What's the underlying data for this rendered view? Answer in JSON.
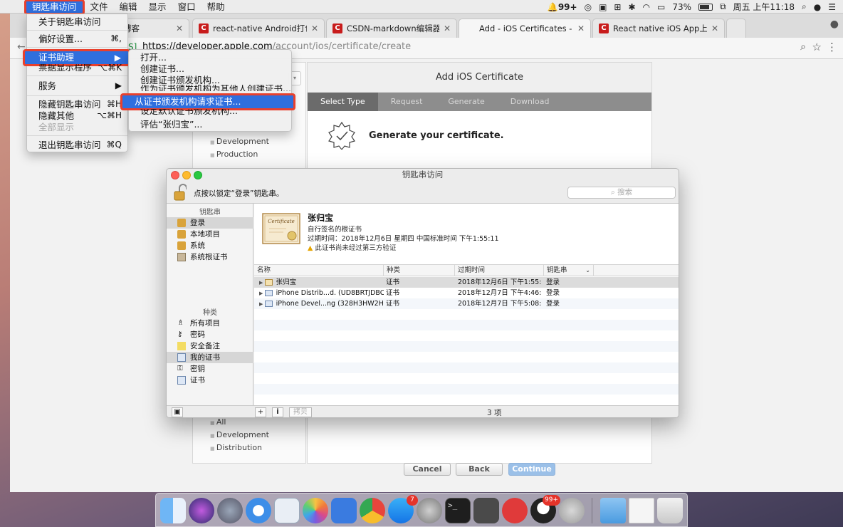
{
  "menubar": {
    "items": [
      "钥匙串访问",
      "文件",
      "编辑",
      "显示",
      "窗口",
      "帮助"
    ],
    "right": {
      "notifications": "99+",
      "battery": "73%",
      "clock": "周五 上午11:18"
    }
  },
  "browser": {
    "tabs": [
      {
        "label": "博客"
      },
      {
        "label": "react-native Android打包apk -"
      },
      {
        "label": "CSDN-markdown编辑器"
      },
      {
        "label": "Add - iOS Certificates - Apple"
      },
      {
        "label": "React native iOS App上架流程"
      }
    ],
    "url": {
      "scheme_tail": "S]",
      "host": "https://developer.apple.com",
      "path": "/account/ios/certificate/create"
    }
  },
  "page": {
    "panel_title": "Add iOS Certificate",
    "steps": [
      "Select Type",
      "Request",
      "Generate",
      "Download"
    ],
    "heading": "Generate your certificate.",
    "sidebar_top": [
      "Development",
      "Production"
    ],
    "sidebar_bottom": [
      "All",
      "Development",
      "Distribution"
    ],
    "buttons": {
      "cancel": "Cancel",
      "back": "Back",
      "continue": "Continue"
    }
  },
  "app_menu": {
    "items": [
      {
        "label": "关于钥匙串访问",
        "shortcut": ""
      },
      {
        "label": "偏好设置...",
        "shortcut": "⌘,"
      },
      {
        "label": "证书助理",
        "shortcut": "▶"
      },
      {
        "label": "票据显示程序",
        "shortcut": "⌥⌘K"
      },
      {
        "label": "服务",
        "shortcut": "▶"
      },
      {
        "label": "隐藏钥匙串访问",
        "shortcut": "⌘H"
      },
      {
        "label": "隐藏其他",
        "shortcut": "⌥⌘H"
      },
      {
        "label": "全部显示",
        "shortcut": ""
      },
      {
        "label": "退出钥匙串访问",
        "shortcut": "⌘Q"
      }
    ]
  },
  "cert_submenu": {
    "items": [
      "打开...",
      "创建证书...",
      "创建证书颁发机构...",
      "作为证书颁发机构为其他人创建证书...",
      "从证书颁发机构请求证书...",
      "设定默认证书颁发机构...",
      "评估“张归宝”..."
    ]
  },
  "keychain": {
    "title": "钥匙串访问",
    "lock_text": "点按以锁定“登录”钥匙串。",
    "search_placeholder": "搜索",
    "keychains_header": "钥匙串",
    "keychains": [
      "登录",
      "本地项目",
      "系统",
      "系统根证书"
    ],
    "categories_header": "种类",
    "categories": [
      "所有项目",
      "密码",
      "安全备注",
      "我的证书",
      "密钥",
      "证书"
    ],
    "detail": {
      "name": "张归宝",
      "kind": "自行签名的根证书",
      "expiry": "过期时间：2018年12月6日 星期四 中国标准时间 下午1:55:11",
      "warning": "此证书尚未经过第三方验证",
      "cert_text": "Certificate"
    },
    "columns": [
      "名称",
      "种类",
      "过期时间",
      "钥匙串"
    ],
    "rows": [
      {
        "name": "张归宝",
        "kind": "证书",
        "expires": "2018年12月6日 下午1:55:11",
        "keychain": "登录"
      },
      {
        "name": "iPhone Distrib...d. (UD8BRTJDBC)",
        "kind": "证书",
        "expires": "2018年12月7日 下午4:46:...",
        "keychain": "登录"
      },
      {
        "name": "iPhone Devel...ng (328H3HW2HB)",
        "kind": "证书",
        "expires": "2018年12月7日 下午5:08:...",
        "keychain": "登录"
      }
    ],
    "copy_button": "拷贝",
    "count": "3 项"
  },
  "dock": {
    "apps": [
      "finder-icon",
      "siri-icon",
      "launchpad-icon",
      "safari-icon",
      "preview-icon",
      "photos-icon",
      "keynote-icon",
      "chrome-icon",
      "appstore-icon",
      "system-preferences-icon",
      "terminal-icon",
      "sublime-icon",
      "netease-music-icon",
      "qq-icon",
      "keychain-access-icon",
      "folder-icon",
      "document-icon",
      "trash-icon"
    ],
    "badges": {
      "appstore": "7",
      "qq": "99+"
    }
  },
  "colors": {
    "menu_highlight": "#2f6fde",
    "annotation_red": "#e8402d",
    "continue_button": "#9bc0e8"
  }
}
